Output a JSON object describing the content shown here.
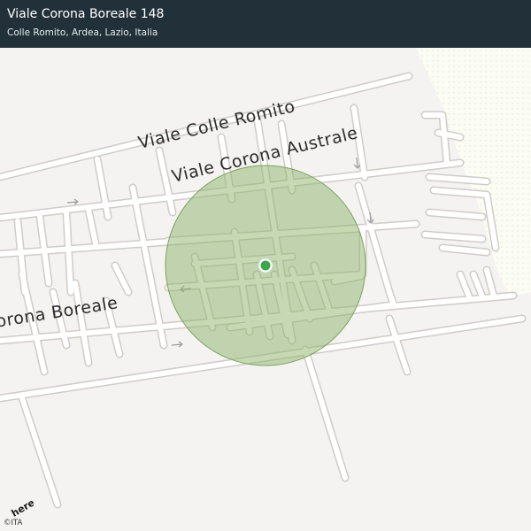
{
  "header": {
    "title": "Viale Corona Boreale 148",
    "subtitle": "Colle Romito, Ardea, Lazio, Italia"
  },
  "map": {
    "street_labels": {
      "colle_romito": "Viale Colle Romito",
      "corona_australe": "Viale Corona Australe",
      "corona_boreale": "Viale Corona Boreale"
    },
    "location_marker": {
      "icon": "location-dot-icon",
      "color": "#3aa84a"
    },
    "accuracy_circle_color": "#8db46a",
    "background_color": "#f4f3f2",
    "road_color": "#ffffff",
    "road_edge_color": "#d0cdca"
  },
  "footer": {
    "logo_text": "here",
    "attribution": "©ITA"
  }
}
